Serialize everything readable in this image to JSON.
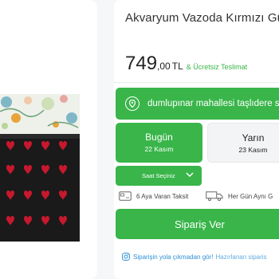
{
  "product": {
    "title": "Akvaryum Vazoda Kırmızı Gü",
    "price_integer": "749",
    "price_decimal": ",00",
    "currency": "TL",
    "shipping": "& Ücretsiz Teslimat"
  },
  "location": {
    "text": "dumlupınar mahallesi taşlıdere sol"
  },
  "delivery_days": [
    {
      "name": "Bugün",
      "date": "22 Kasım",
      "selected": true
    },
    {
      "name": "Yarın",
      "date": "23 Kasım",
      "selected": false
    }
  ],
  "time_select": {
    "label": "Saat Seçiniz"
  },
  "features": [
    {
      "icon": "card-icon",
      "label": "6 Aya Varan Taksit"
    },
    {
      "icon": "truck-icon",
      "label": "Her Gün Aynı G"
    }
  ],
  "order_button": {
    "label": "Sipariş Ver"
  },
  "promo": {
    "part1": "Siparişin yola çıkmadan gör!",
    "part2": "Hazırlanan siparis"
  },
  "colors": {
    "accent": "#39b54a",
    "link": "#2d8fd5"
  }
}
